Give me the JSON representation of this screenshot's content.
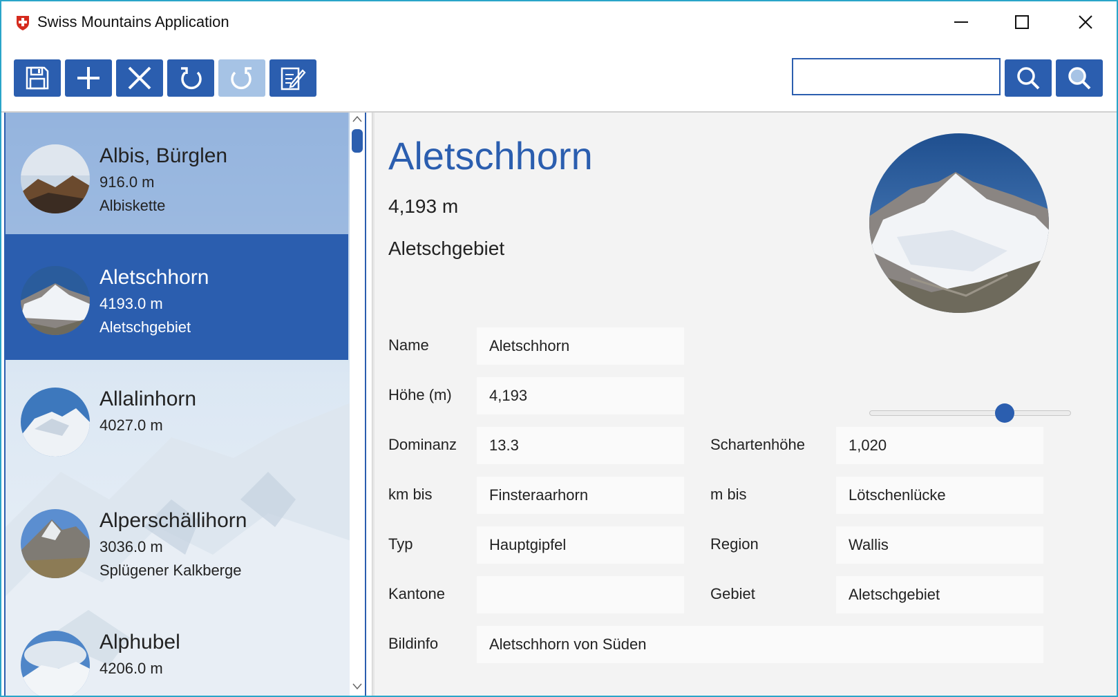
{
  "window": {
    "title": "Swiss Mountains Application",
    "accent": "#2b5eaf"
  },
  "toolbar": {
    "buttons": [
      {
        "name": "save",
        "icon": "floppy-disk-icon",
        "enabled": true
      },
      {
        "name": "add",
        "icon": "plus-icon",
        "enabled": true
      },
      {
        "name": "delete",
        "icon": "x-icon",
        "enabled": true
      },
      {
        "name": "undo",
        "icon": "undo-icon",
        "enabled": true
      },
      {
        "name": "redo",
        "icon": "redo-icon",
        "enabled": false
      },
      {
        "name": "edit",
        "icon": "edit-note-icon",
        "enabled": true
      }
    ],
    "search_value": "",
    "search_icons": [
      "search-icon",
      "search-filled-icon"
    ]
  },
  "list": {
    "items": [
      {
        "name": "Albis, Bürglen",
        "height": "916.0 m",
        "region": "Albiskette",
        "state": "hover"
      },
      {
        "name": "Aletschhorn",
        "height": "4193.0 m",
        "region": "Aletschgebiet",
        "state": "selected"
      },
      {
        "name": "Allalinhorn",
        "height": "4027.0 m",
        "region": "",
        "state": ""
      },
      {
        "name": "Alperschällihorn",
        "height": "3036.0 m",
        "region": "Splügener Kalkberge",
        "state": ""
      },
      {
        "name": "Alphubel",
        "height": "4206.0 m",
        "region": "",
        "state": ""
      }
    ]
  },
  "detail": {
    "title": "Aletschhorn",
    "height": "4,193 m",
    "region": "Aletschgebiet",
    "slider_value": 0.69,
    "fields": {
      "name_label": "Name",
      "name_value": "Aletschhorn",
      "hoehe_label": "Höhe (m)",
      "hoehe_value": "4,193",
      "dominanz_label": "Dominanz",
      "dominanz_value": "13.3",
      "schartenhoehe_label": "Schartenhöhe",
      "schartenhoehe_value": "1,020",
      "kmbis_label": "km bis",
      "kmbis_value": "Finsteraarhorn",
      "mbis_label": "m bis",
      "mbis_value": "Lötschenlücke",
      "typ_label": "Typ",
      "typ_value": "Hauptgipfel",
      "region_label": "Region",
      "region_value": "Wallis",
      "kantone_label": "Kantone",
      "kantone_value": "",
      "gebiet_label": "Gebiet",
      "gebiet_value": "Aletschgebiet",
      "bildinfo_label": "Bildinfo",
      "bildinfo_value": "Aletschhorn von Süden"
    }
  }
}
